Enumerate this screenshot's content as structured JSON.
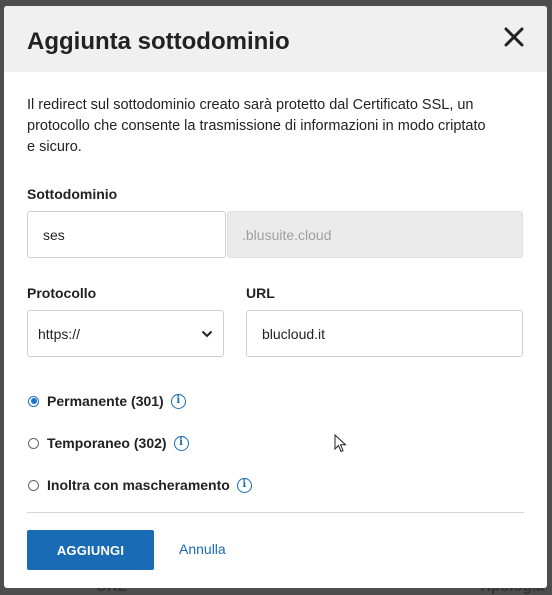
{
  "background": {
    "left_text": "URL",
    "right_text": "Tipologia"
  },
  "dialog": {
    "title": "Aggiunta sottodominio",
    "close_icon": "close-icon",
    "intro": "Il redirect sul sottodominio creato sarà protetto dal Certificato SSL, un protocollo che consente la trasmissione di informazioni in modo criptato e sicuro."
  },
  "form": {
    "subdomain": {
      "label": "Sottodominio",
      "value": "ses",
      "suffix": ".blusuite.cloud"
    },
    "protocol": {
      "label": "Protocollo",
      "selected": "https://"
    },
    "url": {
      "label": "URL",
      "value": "blucloud.it"
    },
    "redirect_types": [
      {
        "label": "Permanente (301)",
        "checked": true
      },
      {
        "label": "Temporaneo (302)",
        "checked": false
      },
      {
        "label": "Inoltra con mascheramento",
        "checked": false
      }
    ]
  },
  "actions": {
    "primary": "AGGIUNGI",
    "cancel": "Annulla"
  },
  "colors": {
    "accent": "#1a6bb5",
    "header_bg": "#f0f0f0",
    "overlay": "#4d4d4d"
  }
}
